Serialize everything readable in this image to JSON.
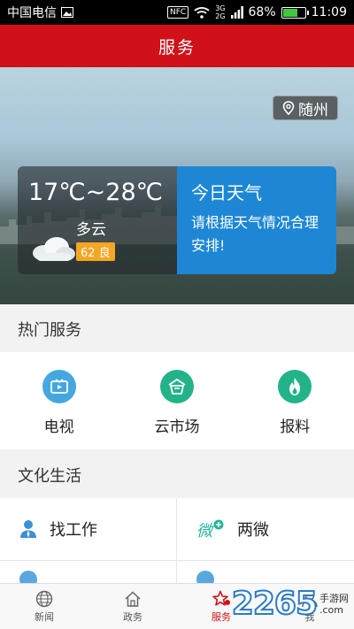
{
  "status_bar": {
    "carrier": "中国电信",
    "nfc": "NFC",
    "net_top": "3G",
    "net_bottom": "2G",
    "battery": "68%",
    "battery_level": 0.68,
    "time": "11:09"
  },
  "header": {
    "title": "服务"
  },
  "weather": {
    "city": "随州",
    "temperature": "17℃~28℃",
    "condition": "多云",
    "aqi": "62 良",
    "today_title": "今日天气",
    "today_text": "请根据天气情况合理安排!"
  },
  "hot_services": {
    "title": "热门服务",
    "items": [
      {
        "label": "电视",
        "icon": "tv-icon",
        "color": "#45a7e0"
      },
      {
        "label": "云市场",
        "icon": "cloud-market-icon",
        "color": "#22b38a"
      },
      {
        "label": "报料",
        "icon": "fire-icon",
        "color": "#22b38a"
      }
    ]
  },
  "culture": {
    "title": "文化生活",
    "items": [
      {
        "label": "找工作",
        "icon": "person-icon"
      },
      {
        "label": "两微",
        "icon": "weibo-wechat-icon"
      }
    ]
  },
  "bottom_nav": {
    "items": [
      {
        "label": "新闻",
        "icon": "globe-icon",
        "active": false
      },
      {
        "label": "政务",
        "icon": "home-icon",
        "active": false
      },
      {
        "label": "服务",
        "icon": "star-icon",
        "active": true
      },
      {
        "label": "我",
        "icon": "user-icon",
        "active": false
      }
    ]
  },
  "watermark": {
    "number": "2265",
    "suffix": ".com",
    "site": "手游网"
  },
  "colors": {
    "brand_red": "#d01119",
    "weather_blue": "#1d87d6",
    "aqi_orange": "#f5a623"
  }
}
